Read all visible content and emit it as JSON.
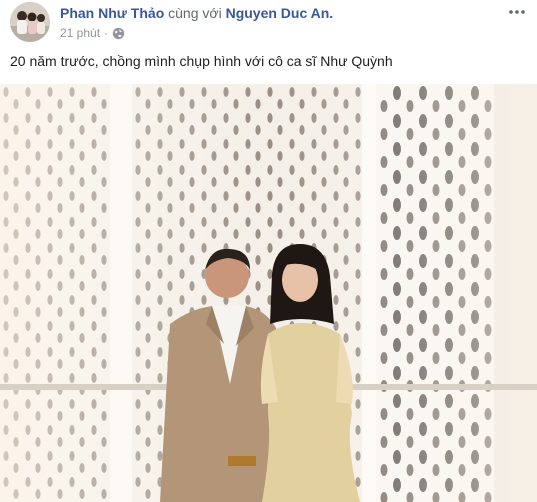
{
  "post": {
    "author_name": "Phan Như Thảo",
    "with_text": "cùng với",
    "tagged_name": "Nguyen Duc An.",
    "timestamp": "21 phút",
    "privacy_icon": "globe-icon",
    "more_icon": "ellipsis-icon",
    "caption": "20 năm trước, chồng mình chụp hình với cô ca sĩ Như Quỳnh"
  },
  "colors": {
    "link": "#385898",
    "meta": "#90949c",
    "text": "#1c1e21"
  }
}
